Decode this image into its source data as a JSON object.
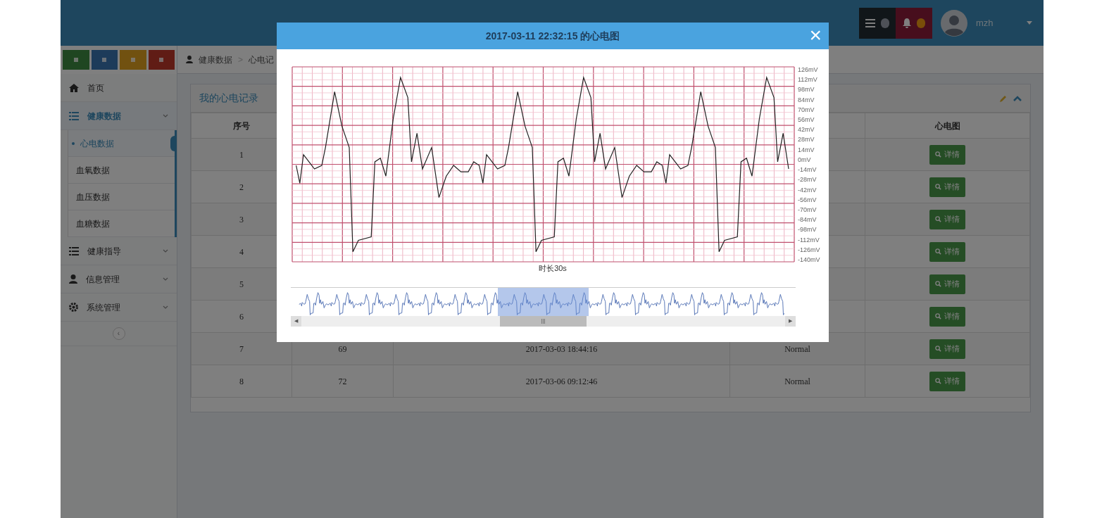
{
  "header": {
    "username": "mzh"
  },
  "sidebar": {
    "items": [
      {
        "label": "首页",
        "kind": "home",
        "selected": false
      },
      {
        "label": "健康数据",
        "kind": "list",
        "selected": true,
        "children": [
          {
            "label": "心电数据",
            "selected": true
          },
          {
            "label": "血氧数据",
            "selected": false
          },
          {
            "label": "血压数据",
            "selected": false
          },
          {
            "label": "血糖数据",
            "selected": false
          }
        ]
      },
      {
        "label": "健康指导",
        "kind": "list",
        "selected": false
      },
      {
        "label": "信息管理",
        "kind": "user",
        "selected": false
      },
      {
        "label": "系统管理",
        "kind": "gear",
        "selected": false
      }
    ],
    "collapse_button": "‹"
  },
  "breadcrumb": {
    "items": [
      "健康数据",
      "心电记"
    ],
    "separator": ">"
  },
  "panel": {
    "title": "我的心电记录",
    "table": {
      "columns": [
        "序号",
        "",
        "",
        "",
        "心电图"
      ],
      "rows": [
        {
          "cells": [
            "1",
            "",
            "",
            ""
          ],
          "button": "详情"
        },
        {
          "cells": [
            "2",
            "",
            "",
            ""
          ],
          "button": "详情"
        },
        {
          "cells": [
            "3",
            "",
            "",
            ""
          ],
          "button": "详情"
        },
        {
          "cells": [
            "4",
            "",
            "",
            ""
          ],
          "button": "详情"
        },
        {
          "cells": [
            "5",
            "",
            "",
            ""
          ],
          "button": "详情"
        },
        {
          "cells": [
            "6",
            "",
            "",
            ""
          ],
          "button": "详情"
        },
        {
          "cells": [
            "7",
            "69",
            "2017-03-03 18:44:16",
            "Normal"
          ],
          "button": "详情"
        },
        {
          "cells": [
            "8",
            "72",
            "2017-03-06 09:12:46",
            "Normal"
          ],
          "button": "详情"
        }
      ]
    }
  },
  "modal": {
    "title": "2017-03-11 22:32:15 的心电图",
    "close": "×",
    "y_axis_labels": [
      "126mV",
      "112mV",
      "98mV",
      "84mV",
      "70mV",
      "56mV",
      "42mV",
      "28mV",
      "14mV",
      "0mV",
      "-14mV",
      "-28mV",
      "-42mV",
      "-56mV",
      "-70mV",
      "-84mV",
      "-98mV",
      "-112mV",
      "-126mV",
      "-140mV"
    ],
    "x_label": "时长30s",
    "navigator": {
      "left_arrow": "◀",
      "right_arrow": "▶",
      "grip": "|||"
    }
  }
}
